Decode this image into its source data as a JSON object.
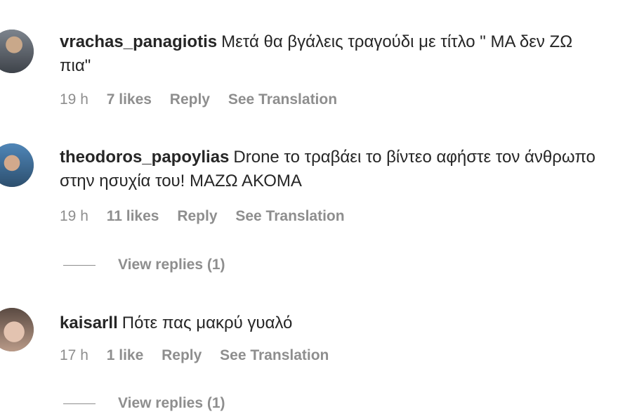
{
  "comments": [
    {
      "username": "vrachas_panagiotis",
      "text": "Μετά θα βγάλεις τραγούδι με τίτλο \" ΜΑ δεν ΖΩ πια\"",
      "time": "19 h",
      "likes": "7 likes",
      "reply_label": "Reply",
      "translate_label": "See Translation"
    },
    {
      "username": "theodoros_papoylias",
      "text": "Drone το τραβάει το βίντεο αφήστε τον άνθρωπο στην ησυχία του! ΜΑΖΩ ΑΚΟΜΑ",
      "time": "19 h",
      "likes": "11 likes",
      "reply_label": "Reply",
      "translate_label": "See Translation",
      "view_replies": "View replies (1)"
    },
    {
      "username": "kaisarll",
      "text": "Πότε πας μακρύ γυαλό",
      "time": "17 h",
      "likes": "1 like",
      "reply_label": "Reply",
      "translate_label": "See Translation",
      "view_replies": "View replies (1)"
    }
  ],
  "colors": {
    "text": "#262626",
    "secondary": "#8e8e8e",
    "background": "#ffffff"
  }
}
